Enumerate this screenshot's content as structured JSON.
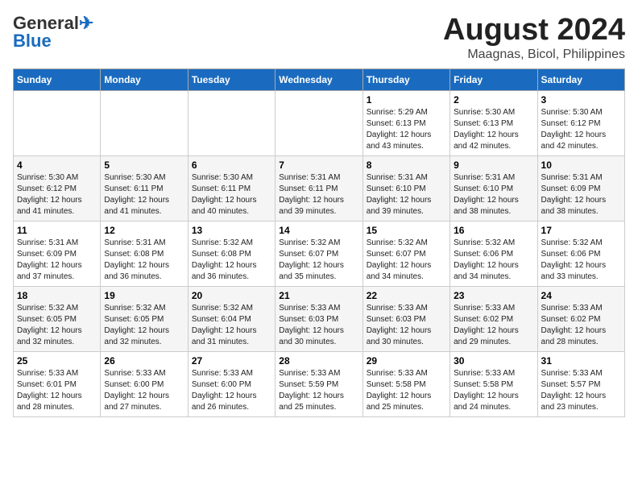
{
  "header": {
    "logo_line1": "General",
    "logo_line2": "Blue",
    "main_title": "August 2024",
    "subtitle": "Maagnas, Bicol, Philippines"
  },
  "days_of_week": [
    "Sunday",
    "Monday",
    "Tuesday",
    "Wednesday",
    "Thursday",
    "Friday",
    "Saturday"
  ],
  "weeks": [
    [
      {
        "day": "",
        "info": ""
      },
      {
        "day": "",
        "info": ""
      },
      {
        "day": "",
        "info": ""
      },
      {
        "day": "",
        "info": ""
      },
      {
        "day": "1",
        "info": "Sunrise: 5:29 AM\nSunset: 6:13 PM\nDaylight: 12 hours\nand 43 minutes."
      },
      {
        "day": "2",
        "info": "Sunrise: 5:30 AM\nSunset: 6:13 PM\nDaylight: 12 hours\nand 42 minutes."
      },
      {
        "day": "3",
        "info": "Sunrise: 5:30 AM\nSunset: 6:12 PM\nDaylight: 12 hours\nand 42 minutes."
      }
    ],
    [
      {
        "day": "4",
        "info": "Sunrise: 5:30 AM\nSunset: 6:12 PM\nDaylight: 12 hours\nand 41 minutes."
      },
      {
        "day": "5",
        "info": "Sunrise: 5:30 AM\nSunset: 6:11 PM\nDaylight: 12 hours\nand 41 minutes."
      },
      {
        "day": "6",
        "info": "Sunrise: 5:30 AM\nSunset: 6:11 PM\nDaylight: 12 hours\nand 40 minutes."
      },
      {
        "day": "7",
        "info": "Sunrise: 5:31 AM\nSunset: 6:11 PM\nDaylight: 12 hours\nand 39 minutes."
      },
      {
        "day": "8",
        "info": "Sunrise: 5:31 AM\nSunset: 6:10 PM\nDaylight: 12 hours\nand 39 minutes."
      },
      {
        "day": "9",
        "info": "Sunrise: 5:31 AM\nSunset: 6:10 PM\nDaylight: 12 hours\nand 38 minutes."
      },
      {
        "day": "10",
        "info": "Sunrise: 5:31 AM\nSunset: 6:09 PM\nDaylight: 12 hours\nand 38 minutes."
      }
    ],
    [
      {
        "day": "11",
        "info": "Sunrise: 5:31 AM\nSunset: 6:09 PM\nDaylight: 12 hours\nand 37 minutes."
      },
      {
        "day": "12",
        "info": "Sunrise: 5:31 AM\nSunset: 6:08 PM\nDaylight: 12 hours\nand 36 minutes."
      },
      {
        "day": "13",
        "info": "Sunrise: 5:32 AM\nSunset: 6:08 PM\nDaylight: 12 hours\nand 36 minutes."
      },
      {
        "day": "14",
        "info": "Sunrise: 5:32 AM\nSunset: 6:07 PM\nDaylight: 12 hours\nand 35 minutes."
      },
      {
        "day": "15",
        "info": "Sunrise: 5:32 AM\nSunset: 6:07 PM\nDaylight: 12 hours\nand 34 minutes."
      },
      {
        "day": "16",
        "info": "Sunrise: 5:32 AM\nSunset: 6:06 PM\nDaylight: 12 hours\nand 34 minutes."
      },
      {
        "day": "17",
        "info": "Sunrise: 5:32 AM\nSunset: 6:06 PM\nDaylight: 12 hours\nand 33 minutes."
      }
    ],
    [
      {
        "day": "18",
        "info": "Sunrise: 5:32 AM\nSunset: 6:05 PM\nDaylight: 12 hours\nand 32 minutes."
      },
      {
        "day": "19",
        "info": "Sunrise: 5:32 AM\nSunset: 6:05 PM\nDaylight: 12 hours\nand 32 minutes."
      },
      {
        "day": "20",
        "info": "Sunrise: 5:32 AM\nSunset: 6:04 PM\nDaylight: 12 hours\nand 31 minutes."
      },
      {
        "day": "21",
        "info": "Sunrise: 5:33 AM\nSunset: 6:03 PM\nDaylight: 12 hours\nand 30 minutes."
      },
      {
        "day": "22",
        "info": "Sunrise: 5:33 AM\nSunset: 6:03 PM\nDaylight: 12 hours\nand 30 minutes."
      },
      {
        "day": "23",
        "info": "Sunrise: 5:33 AM\nSunset: 6:02 PM\nDaylight: 12 hours\nand 29 minutes."
      },
      {
        "day": "24",
        "info": "Sunrise: 5:33 AM\nSunset: 6:02 PM\nDaylight: 12 hours\nand 28 minutes."
      }
    ],
    [
      {
        "day": "25",
        "info": "Sunrise: 5:33 AM\nSunset: 6:01 PM\nDaylight: 12 hours\nand 28 minutes."
      },
      {
        "day": "26",
        "info": "Sunrise: 5:33 AM\nSunset: 6:00 PM\nDaylight: 12 hours\nand 27 minutes."
      },
      {
        "day": "27",
        "info": "Sunrise: 5:33 AM\nSunset: 6:00 PM\nDaylight: 12 hours\nand 26 minutes."
      },
      {
        "day": "28",
        "info": "Sunrise: 5:33 AM\nSunset: 5:59 PM\nDaylight: 12 hours\nand 25 minutes."
      },
      {
        "day": "29",
        "info": "Sunrise: 5:33 AM\nSunset: 5:58 PM\nDaylight: 12 hours\nand 25 minutes."
      },
      {
        "day": "30",
        "info": "Sunrise: 5:33 AM\nSunset: 5:58 PM\nDaylight: 12 hours\nand 24 minutes."
      },
      {
        "day": "31",
        "info": "Sunrise: 5:33 AM\nSunset: 5:57 PM\nDaylight: 12 hours\nand 23 minutes."
      }
    ]
  ]
}
